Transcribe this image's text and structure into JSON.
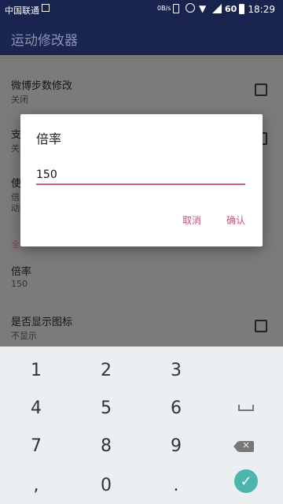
{
  "status_bar": {
    "carrier": "中国联通",
    "speed": "0B/s",
    "battery_level": "60",
    "time": "18:29",
    "icons": [
      "image-icon",
      "vibrate-icon",
      "alarm-icon",
      "wifi-icon",
      "signal-icon",
      "battery-icon"
    ]
  },
  "app_bar": {
    "title": "运动修改器"
  },
  "list": {
    "items": [
      {
        "title": "微博步数修改",
        "subtitle": "关闭",
        "checked": false
      },
      {
        "title": "支",
        "subtitle": "关",
        "checked": false
      },
      {
        "title": "使",
        "subtitle": "倍",
        "subtitle2": "动"
      }
    ],
    "section_label": "全",
    "bottom_items": [
      {
        "title": "倍率",
        "subtitle": "150"
      },
      {
        "title": "是否显示图标",
        "subtitle": "不显示",
        "checked": false
      }
    ]
  },
  "dialog": {
    "title": "倍率",
    "input_value": "150",
    "cancel_label": "取消",
    "ok_label": "确认",
    "accent_color": "#d24a7e"
  },
  "keyboard": {
    "rows": [
      [
        "1",
        "2",
        "3"
      ],
      [
        "4",
        "5",
        "6"
      ],
      [
        "7",
        "8",
        "9"
      ],
      [
        ",",
        "0",
        "."
      ]
    ],
    "special_keys": [
      "space-icon",
      "backspace-icon",
      "done-check-icon"
    ],
    "done_color": "#4db6ac"
  }
}
